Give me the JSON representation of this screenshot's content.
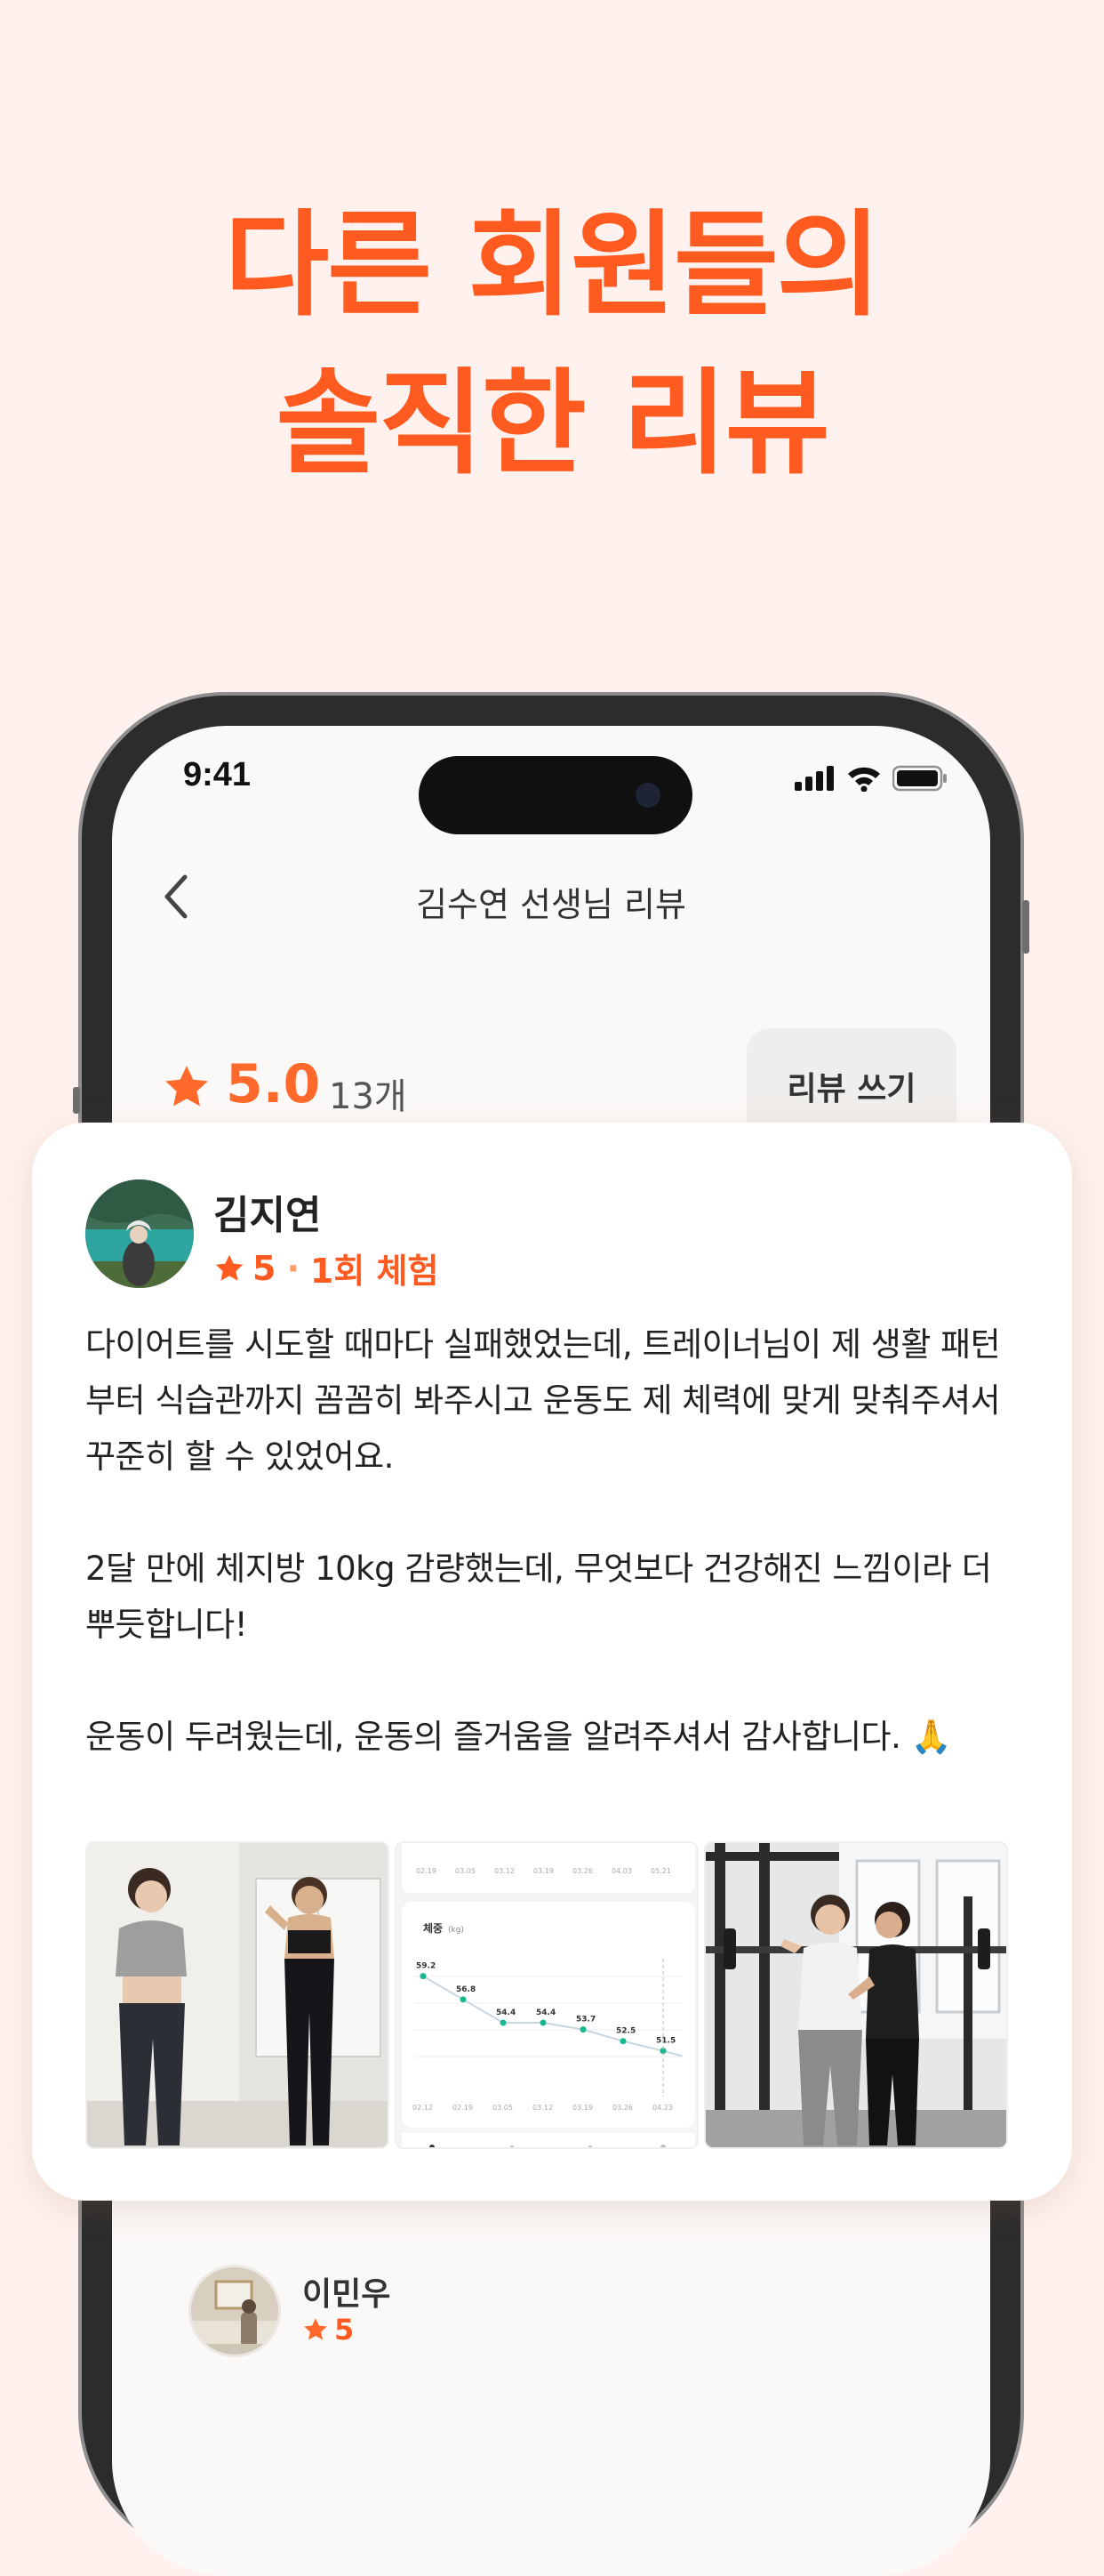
{
  "headline": {
    "line1": "다른 회원들의",
    "line2": "솔직한 리뷰"
  },
  "status_bar": {
    "time": "9:41"
  },
  "nav": {
    "title": "김수연 선생님 리뷰",
    "back_icon": "chevron-left-icon"
  },
  "summary": {
    "rating": "5.0",
    "count": "13개",
    "write_button": "리뷰 쓰기"
  },
  "review": {
    "name": "김지연",
    "rating": "5",
    "separator": "·",
    "sessions": "1회 체험",
    "text": "다이어트를 시도할 때마다 실패했었는데, 트레이너님이 제 생활 패턴부터 식습관까지 꼼꼼히 봐주시고 운동도 제 체력에 맞게 맞춰주셔서 꾸준히 할 수 있었어요.\n\n2달 만에 체지방 10kg 감량했는데, 무엇보다 건강해진 느낌이라 더 뿌듯합니다!\n\n운동이 두려웠는데, 운동의 즐거움을 알려주셔서 감사합니다. 🙏",
    "chart_photo": {
      "label": "체중",
      "unit": "(kg)",
      "top_dates": [
        "02.19",
        "03.05",
        "03.12",
        "03.19",
        "03.26",
        "04.03",
        "05.21"
      ],
      "dates": [
        "02.12",
        "02.19",
        "03.05",
        "03.12",
        "03.19",
        "03.26",
        "04.23"
      ],
      "values": [
        "59.2",
        "56.8",
        "54.4",
        "54.4",
        "53.7",
        "52.5",
        "51.5"
      ]
    }
  },
  "review2": {
    "name": "이민우",
    "rating": "5"
  },
  "colors": {
    "accent": "#FF5A1F",
    "background": "#FFF2EE"
  }
}
